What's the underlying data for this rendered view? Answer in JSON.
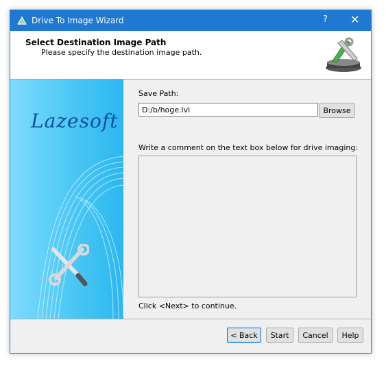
{
  "window": {
    "title": "Drive To Image Wizard",
    "help_glyph": "?",
    "close_glyph": "✕"
  },
  "header": {
    "title": "Select Destination Image Path",
    "subtitle": "Please specify the destination image path."
  },
  "sidebar": {
    "brand": "Lazesoft"
  },
  "form": {
    "save_path_label": "Save Path:",
    "save_path_value": "D:/b/hoge.lvi",
    "browse_label": "Browse",
    "comment_label": "Write a comment on the text box below for drive imaging:",
    "comment_value": "",
    "continue_hint": "Click <Next> to continue."
  },
  "buttons": {
    "back": "< Back",
    "start": "Start",
    "cancel": "Cancel",
    "help": "Help"
  },
  "colors": {
    "titlebar": "#1f78d1",
    "sidebar": "#4fc9f5",
    "brand_text": "#0e4f9c"
  }
}
